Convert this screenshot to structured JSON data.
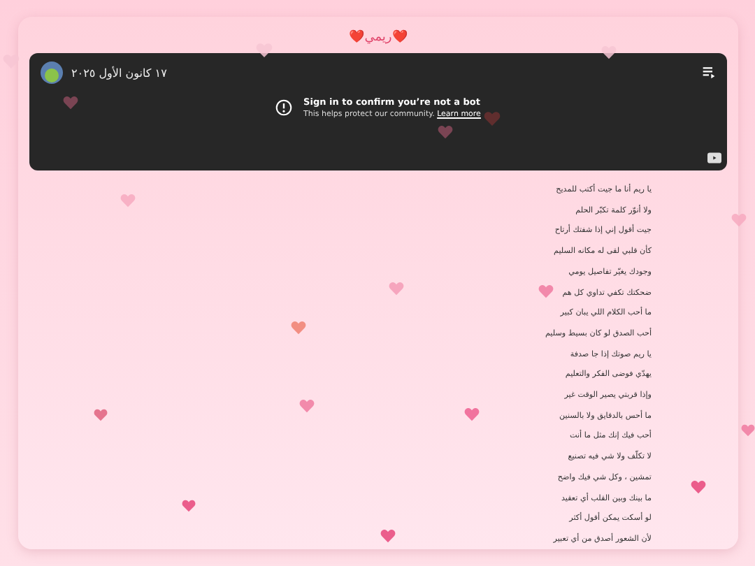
{
  "title": "❤️ريمي❤️",
  "video": {
    "date": "١٧ كانون الأول ٢٠٢٥",
    "message": "Sign in to confirm you’re not a bot",
    "subtext": "This helps protect our community.",
    "link": "Learn more"
  },
  "poem": [
    "يا ريم أنا ما جيت أكتب للمديح",
    "ولا أنوّر كلمة تكبّر الحلم",
    "جيت أقول إني إذا شفتك أرتاح",
    "كأن قلبي لقى له مكانه السليم",
    "وجودك يغيّر تفاصيل يومي",
    "ضحكتك تكفي تداوي كل هم",
    "ما أحب الكلام اللي يبان كبير",
    "أحب الصدق لو كان بسيط وسليم",
    "يا ريم صوتك إذا جا صدفة",
    "يهدّي فوضى الفكر والتعليم",
    "وإذا قربتي يصير الوقت غير",
    "ما أحس بالدقايق ولا بالسنين",
    "أحب فيك إنك مثل ما أنت",
    "لا تكلّف ولا شي فيه تصنيع",
    "تمشين ، وكل شي فيك واضح",
    "ما بينك وبين القلب أي تعقيد",
    "لو أسكت يمكن أقول أكثر",
    "لأن الشعور أصدق من أي تعبير"
  ]
}
